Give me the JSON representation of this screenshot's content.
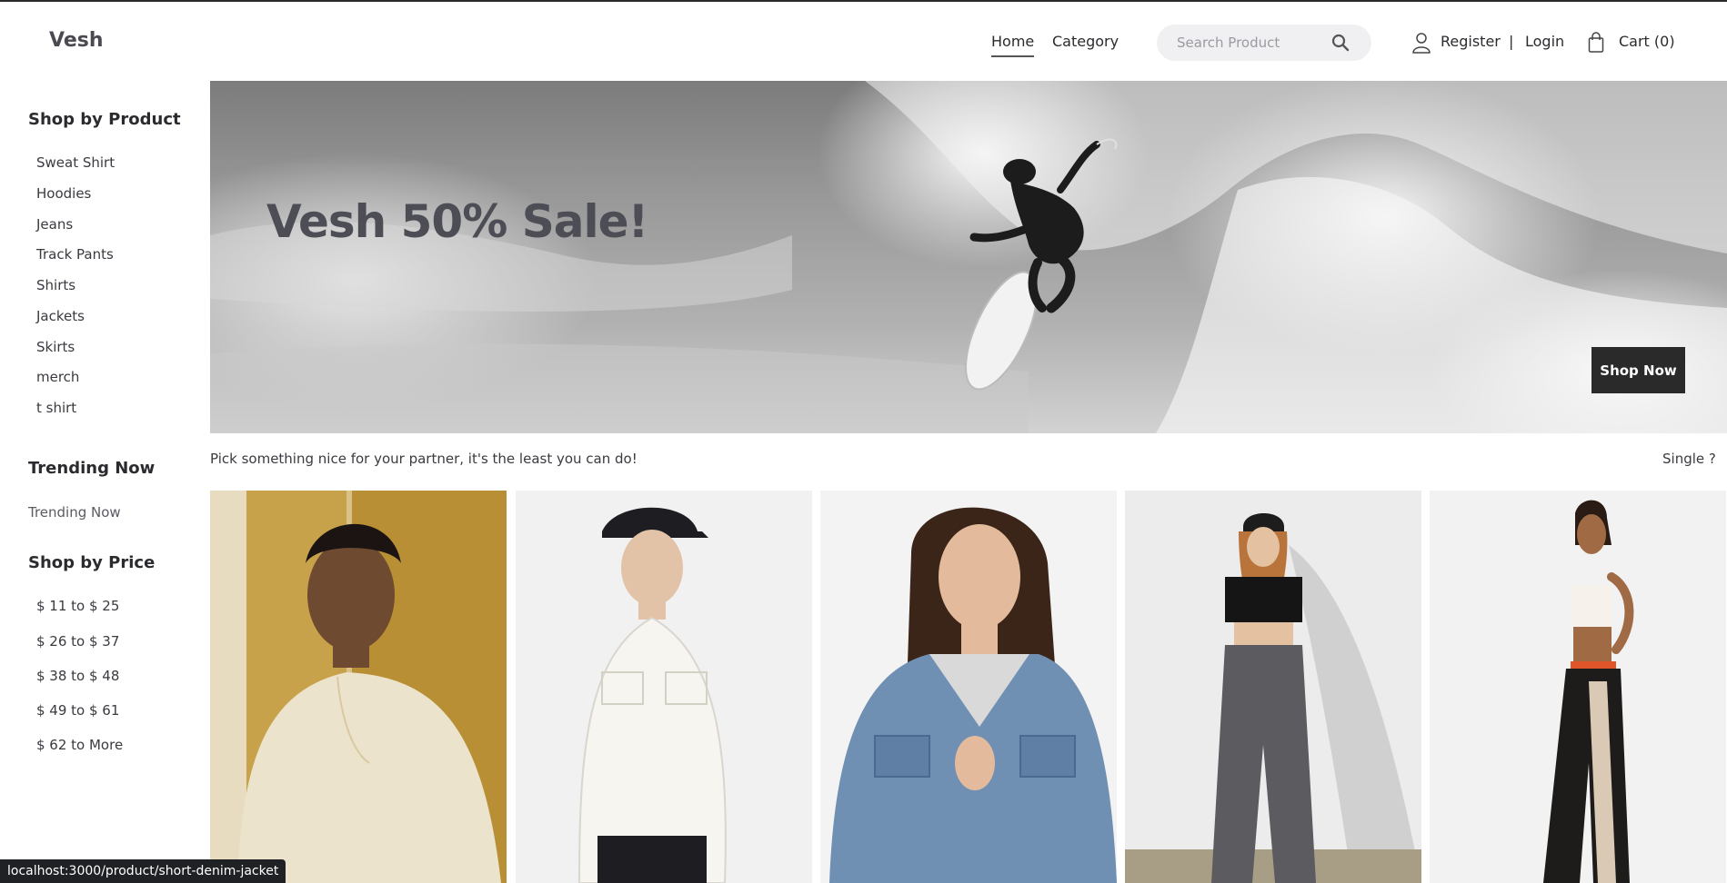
{
  "header": {
    "logo": "Vesh",
    "nav": {
      "home": "Home",
      "category": "Category"
    },
    "search_placeholder": "Search Product",
    "register": "Register",
    "separator": "|",
    "login": "Login",
    "cart": "Cart (0)"
  },
  "sidebar": {
    "shop_by_product": {
      "heading": "Shop by Product",
      "items": [
        "Sweat Shirt",
        "Hoodies",
        "Jeans",
        "Track Pants",
        "Shirts",
        "Jackets",
        "Skirts",
        "merch",
        "t shirt"
      ]
    },
    "trending": {
      "heading": "Trending Now",
      "items": [
        "Trending Now"
      ]
    },
    "shop_by_price": {
      "heading": "Shop by Price",
      "items": [
        "$ 11 to $ 25",
        "$ 26 to $ 37",
        "$ 38 to $ 48",
        "$ 49 to $ 61",
        "$ 62 to More"
      ]
    }
  },
  "banner": {
    "title": "Vesh 50% Sale!",
    "cta": "Shop Now"
  },
  "tagline": "Pick something nice for your partner, it's the least you can do!",
  "single_link": "Single ?",
  "status_url": "localhost:3000/product/short-denim-jacket",
  "colors": {
    "primary_dark": "#2a2a2a",
    "text": "#2b2b2f",
    "search_bg": "#f0f0f2"
  }
}
